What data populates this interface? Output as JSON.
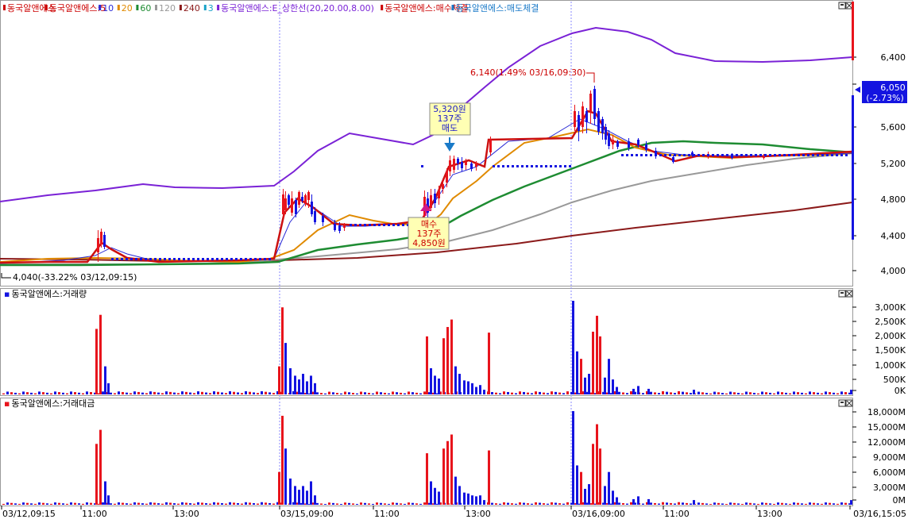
{
  "price_panel": {
    "legend": [
      {
        "text": "동국알앤에스",
        "color": "#cc0000"
      },
      {
        "text": "동국알앤에스:5",
        "color": "#cc0000"
      },
      {
        "text": "10",
        "color": "#2a2ad6"
      },
      {
        "text": "20",
        "color": "#e08a00"
      },
      {
        "text": "60",
        "color": "#1e8c32"
      },
      {
        "text": "120",
        "color": "#999999"
      },
      {
        "text": "240",
        "color": "#8b1a1a"
      },
      {
        "text": "3",
        "color": "#1aa3c8"
      },
      {
        "text": "동국알앤에스:E_상한선(20,20.00,8.00)",
        "color": "#7a22d6"
      },
      {
        "text": "동국알앤에스:매수체결",
        "color": "#cc0000"
      },
      {
        "text": "동국알앤에스:매도체결",
        "color": "#1a7ac8"
      }
    ],
    "y_ticks": [
      "6,400",
      "6,000",
      "5,600",
      "5,200",
      "4,800",
      "4,400",
      "4,000"
    ],
    "current_price": "6,050",
    "current_change": "(-2.73%)",
    "high_label": "6,140(1.49% 03/16,09:30)",
    "low_label": "4,040(-33.22% 03/12,09:15)",
    "sell_box": [
      "5,320원",
      "137주",
      "매도"
    ],
    "buy_box": [
      "매수",
      "137주",
      "4,850원"
    ]
  },
  "volume_panel": {
    "title": "동국알앤에스:거래량",
    "y_ticks": [
      "3,000K",
      "2,500K",
      "2,000K",
      "1,500K",
      "1,000K",
      "500K",
      "0K"
    ]
  },
  "amount_panel": {
    "title": "동국알앤에스:거래대금",
    "y_ticks": [
      "18,000M",
      "15,000M",
      "12,000M",
      "9,000M",
      "6,000M",
      "3,000M",
      "0M"
    ]
  },
  "x_ticks": [
    "03/12,09:15",
    "11:00",
    "13:00",
    "03/15,09:00",
    "11:00",
    "13:00",
    "03/16,09:00",
    "11:00",
    "13:00",
    "03/16,15:05"
  ],
  "colors": {
    "up": "#e8141c",
    "down": "#1414e0",
    "ma5": "#cc1010",
    "ma10": "#2a2ad6",
    "ma20": "#e08a00",
    "ma60": "#1e8c32",
    "ma120": "#999999",
    "ma240": "#8b1a1a",
    "envelope": "#7a22d6"
  },
  "icons": [
    "maximize-icon",
    "close-icon"
  ]
}
